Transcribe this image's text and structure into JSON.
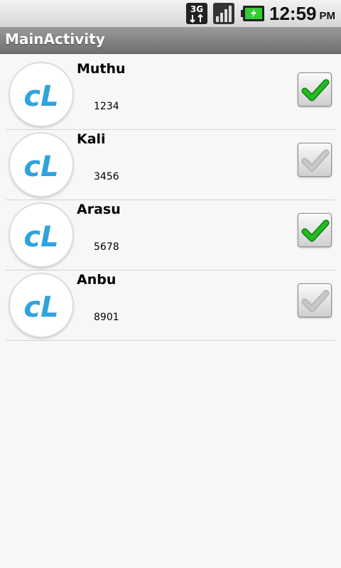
{
  "status_bar": {
    "network_label": "3G",
    "time": "12:59",
    "ampm": "PM",
    "icons": [
      "3g-data-icon",
      "signal-strength-icon",
      "battery-charging-icon"
    ]
  },
  "title_bar": {
    "title": "MainActivity"
  },
  "contacts": [
    {
      "name": "Muthu",
      "number": "1234",
      "checked": true,
      "avatar_text": "cL"
    },
    {
      "name": "Kali",
      "number": "3456",
      "checked": false,
      "avatar_text": "cL"
    },
    {
      "name": "Arasu",
      "number": "5678",
      "checked": true,
      "avatar_text": "cL"
    },
    {
      "name": "Anbu",
      "number": "8901",
      "checked": false,
      "avatar_text": "cL"
    }
  ],
  "colors": {
    "checked_green": "#22bb22",
    "unchecked_grey": "#c8c8c8",
    "avatar_blue": "#2fa3dc",
    "title_text": "#ffffff"
  }
}
